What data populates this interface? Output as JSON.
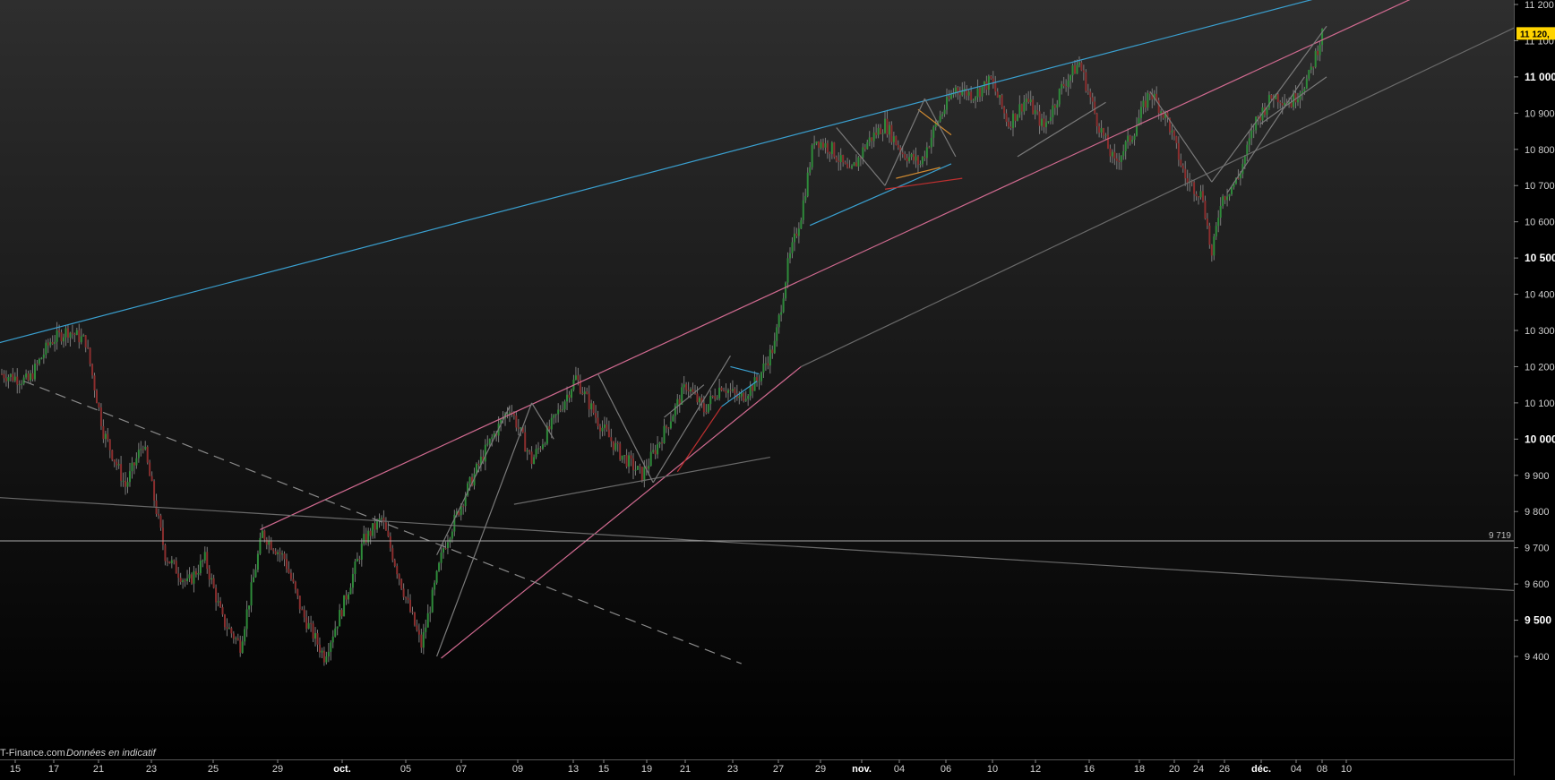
{
  "chart_data": {
    "type": "candlestick",
    "instrument_price_tag": "11 120,",
    "y_range": [
      9350,
      11220
    ],
    "y_ticks": [
      {
        "value": 9400,
        "label": "9 400",
        "major": false
      },
      {
        "value": 9500,
        "label": "9 500",
        "major": true
      },
      {
        "value": 9600,
        "label": "9 600",
        "major": false
      },
      {
        "value": 9700,
        "label": "9 700",
        "major": false
      },
      {
        "value": 9800,
        "label": "9 800",
        "major": false
      },
      {
        "value": 9900,
        "label": "9 900",
        "major": false
      },
      {
        "value": 10000,
        "label": "10 000",
        "major": true
      },
      {
        "value": 10100,
        "label": "10 100",
        "major": false
      },
      {
        "value": 10200,
        "label": "10 200",
        "major": false
      },
      {
        "value": 10300,
        "label": "10 300",
        "major": false
      },
      {
        "value": 10400,
        "label": "10 400",
        "major": false
      },
      {
        "value": 10500,
        "label": "10 500",
        "major": true
      },
      {
        "value": 10600,
        "label": "10 600",
        "major": false
      },
      {
        "value": 10700,
        "label": "10 700",
        "major": false
      },
      {
        "value": 10800,
        "label": "10 800",
        "major": false
      },
      {
        "value": 10900,
        "label": "10 900",
        "major": false
      },
      {
        "value": 11000,
        "label": "11 000",
        "major": true
      },
      {
        "value": 11100,
        "label": "11 100",
        "major": false
      },
      {
        "value": 11200,
        "label": "11 200",
        "major": false
      }
    ],
    "x_ticks": [
      {
        "label": "15",
        "major": false
      },
      {
        "label": "17",
        "major": false
      },
      {
        "label": "21",
        "major": false
      },
      {
        "label": "23",
        "major": false
      },
      {
        "label": "25",
        "major": false
      },
      {
        "label": "29",
        "major": false
      },
      {
        "label": "oct.",
        "major": true
      },
      {
        "label": "05",
        "major": false
      },
      {
        "label": "07",
        "major": false
      },
      {
        "label": "09",
        "major": false
      },
      {
        "label": "13",
        "major": false
      },
      {
        "label": "15",
        "major": false
      },
      {
        "label": "19",
        "major": false
      },
      {
        "label": "21",
        "major": false
      },
      {
        "label": "23",
        "major": false
      },
      {
        "label": "27",
        "major": false
      },
      {
        "label": "29",
        "major": false
      },
      {
        "label": "nov.",
        "major": true
      },
      {
        "label": "04",
        "major": false
      },
      {
        "label": "06",
        "major": false
      },
      {
        "label": "10",
        "major": false
      },
      {
        "label": "12",
        "major": false
      },
      {
        "label": "16",
        "major": false
      },
      {
        "label": "18",
        "major": false
      },
      {
        "label": "20",
        "major": false
      },
      {
        "label": "24",
        "major": false
      },
      {
        "label": "26",
        "major": false
      },
      {
        "label": "déc.",
        "major": true
      },
      {
        "label": "04",
        "major": false
      },
      {
        "label": "08",
        "major": false
      },
      {
        "label": "10",
        "major": false
      }
    ],
    "horizontal_line": {
      "value": 9719,
      "label": "9 719",
      "color": "#aaaaaa"
    },
    "price_path": [
      {
        "i": 0,
        "p": 10180
      },
      {
        "i": 12,
        "p": 10160
      },
      {
        "i": 22,
        "p": 10270
      },
      {
        "i": 30,
        "p": 10300
      },
      {
        "i": 38,
        "p": 10270
      },
      {
        "i": 46,
        "p": 10020
      },
      {
        "i": 56,
        "p": 9870
      },
      {
        "i": 64,
        "p": 9990
      },
      {
        "i": 74,
        "p": 9680
      },
      {
        "i": 84,
        "p": 9600
      },
      {
        "i": 92,
        "p": 9670
      },
      {
        "i": 100,
        "p": 9500
      },
      {
        "i": 108,
        "p": 9430
      },
      {
        "i": 118,
        "p": 9740
      },
      {
        "i": 128,
        "p": 9670
      },
      {
        "i": 136,
        "p": 9520
      },
      {
        "i": 146,
        "p": 9400
      },
      {
        "i": 154,
        "p": 9530
      },
      {
        "i": 164,
        "p": 9720
      },
      {
        "i": 172,
        "p": 9780
      },
      {
        "i": 182,
        "p": 9580
      },
      {
        "i": 190,
        "p": 9430
      },
      {
        "i": 200,
        "p": 9700
      },
      {
        "i": 210,
        "p": 9850
      },
      {
        "i": 220,
        "p": 9980
      },
      {
        "i": 230,
        "p": 10090
      },
      {
        "i": 240,
        "p": 9940
      },
      {
        "i": 250,
        "p": 10050
      },
      {
        "i": 260,
        "p": 10170
      },
      {
        "i": 270,
        "p": 10050
      },
      {
        "i": 280,
        "p": 9960
      },
      {
        "i": 290,
        "p": 9900
      },
      {
        "i": 300,
        "p": 10020
      },
      {
        "i": 310,
        "p": 10150
      },
      {
        "i": 318,
        "p": 10080
      },
      {
        "i": 326,
        "p": 10150
      },
      {
        "i": 334,
        "p": 10110
      },
      {
        "i": 342,
        "p": 10160
      },
      {
        "i": 350,
        "p": 10260
      },
      {
        "i": 356,
        "p": 10480
      },
      {
        "i": 362,
        "p": 10620
      },
      {
        "i": 368,
        "p": 10830
      },
      {
        "i": 376,
        "p": 10800
      },
      {
        "i": 384,
        "p": 10730
      },
      {
        "i": 392,
        "p": 10820
      },
      {
        "i": 400,
        "p": 10870
      },
      {
        "i": 408,
        "p": 10790
      },
      {
        "i": 416,
        "p": 10760
      },
      {
        "i": 424,
        "p": 10880
      },
      {
        "i": 432,
        "p": 10970
      },
      {
        "i": 440,
        "p": 10950
      },
      {
        "i": 448,
        "p": 10990
      },
      {
        "i": 456,
        "p": 10870
      },
      {
        "i": 464,
        "p": 10940
      },
      {
        "i": 472,
        "p": 10860
      },
      {
        "i": 480,
        "p": 10970
      },
      {
        "i": 488,
        "p": 11040
      },
      {
        "i": 496,
        "p": 10880
      },
      {
        "i": 504,
        "p": 10760
      },
      {
        "i": 512,
        "p": 10840
      },
      {
        "i": 520,
        "p": 10960
      },
      {
        "i": 528,
        "p": 10880
      },
      {
        "i": 536,
        "p": 10720
      },
      {
        "i": 544,
        "p": 10670
      },
      {
        "i": 548,
        "p": 10500
      },
      {
        "i": 552,
        "p": 10660
      },
      {
        "i": 560,
        "p": 10720
      },
      {
        "i": 568,
        "p": 10880
      },
      {
        "i": 576,
        "p": 10950
      },
      {
        "i": 584,
        "p": 10930
      },
      {
        "i": 592,
        "p": 11000
      },
      {
        "i": 598,
        "p": 11120
      }
    ],
    "trendlines": [
      {
        "name": "upper-blue-channel",
        "color": "#3aa0d0",
        "style": "solid",
        "from": [
          -5,
          10260
        ],
        "to": [
          610,
          11240
        ]
      },
      {
        "name": "pink-upper",
        "color": "#d06a90",
        "style": "solid",
        "from": [
          117,
          9750
        ],
        "to": [
          640,
          11220
        ]
      },
      {
        "name": "pink-lower",
        "color": "#d06a90",
        "style": "solid",
        "from": [
          199,
          9395
        ],
        "to": [
          362,
          10200
        ]
      },
      {
        "name": "grey-mid-trend",
        "color": "#6a6a6a",
        "style": "solid",
        "from": [
          362,
          10200
        ],
        "to": [
          690,
          11150
        ]
      },
      {
        "name": "grey-long-down",
        "color": "#6a6a6a",
        "style": "solid",
        "from": [
          -5,
          9840
        ],
        "to": [
          690,
          9580
        ]
      },
      {
        "name": "dashed-down",
        "color": "#8a8a8a",
        "style": "dashed",
        "from": [
          10,
          10160
        ],
        "to": [
          335,
          9380
        ]
      },
      {
        "name": "grey-small-flat",
        "color": "#6a6a6a",
        "style": "solid",
        "from": [
          232,
          9820
        ],
        "to": [
          348,
          9950
        ]
      },
      {
        "name": "blue-mid-1",
        "color": "#3aa0d0",
        "style": "solid",
        "from": [
          366,
          10590
        ],
        "to": [
          430,
          10760
        ]
      },
      {
        "name": "blue-small-2",
        "color": "#3aa0d0",
        "style": "solid",
        "from": [
          330,
          10200
        ],
        "to": [
          343,
          10180
        ]
      },
      {
        "name": "blue-small-3",
        "color": "#3aa0d0",
        "style": "solid",
        "from": [
          326,
          10090
        ],
        "to": [
          342,
          10160
        ]
      },
      {
        "name": "red-small-1",
        "color": "#c03030",
        "style": "solid",
        "from": [
          306,
          9910
        ],
        "to": [
          326,
          10090
        ]
      },
      {
        "name": "red-mid-1",
        "color": "#c03030",
        "style": "solid",
        "from": [
          400,
          10690
        ],
        "to": [
          435,
          10720
        ]
      },
      {
        "name": "orange-mid-1",
        "color": "#d08a30",
        "style": "solid",
        "from": [
          415,
          10910
        ],
        "to": [
          430,
          10840
        ]
      },
      {
        "name": "orange-mid-2",
        "color": "#d08a30",
        "style": "solid",
        "from": [
          405,
          10720
        ],
        "to": [
          425,
          10750
        ]
      },
      {
        "name": "grey-pattern-1",
        "color": "#7a7a7a",
        "style": "solid",
        "from": [
          197,
          9400
        ],
        "to": [
          240,
          10100
        ]
      },
      {
        "name": "grey-pattern-2",
        "color": "#7a7a7a",
        "style": "solid",
        "from": [
          197,
          9680
        ],
        "to": [
          230,
          10090
        ]
      },
      {
        "name": "grey-pattern-3",
        "color": "#7a7a7a",
        "style": "solid",
        "from": [
          240,
          10100
        ],
        "to": [
          250,
          10000
        ]
      },
      {
        "name": "grey-pattern-4",
        "color": "#7a7a7a",
        "style": "solid",
        "from": [
          270,
          10180
        ],
        "to": [
          295,
          9880
        ]
      },
      {
        "name": "grey-pattern-5",
        "color": "#7a7a7a",
        "style": "solid",
        "from": [
          295,
          9880
        ],
        "to": [
          330,
          10230
        ]
      },
      {
        "name": "grey-pattern-6",
        "color": "#7a7a7a",
        "style": "solid",
        "from": [
          300,
          10060
        ],
        "to": [
          318,
          10150
        ]
      },
      {
        "name": "grey-pattern-7",
        "color": "#7a7a7a",
        "style": "solid",
        "from": [
          378,
          10860
        ],
        "to": [
          400,
          10700
        ]
      },
      {
        "name": "grey-pattern-8",
        "color": "#7a7a7a",
        "style": "solid",
        "from": [
          400,
          10700
        ],
        "to": [
          418,
          10940
        ]
      },
      {
        "name": "grey-pattern-9",
        "color": "#7a7a7a",
        "style": "solid",
        "from": [
          418,
          10940
        ],
        "to": [
          432,
          10780
        ]
      },
      {
        "name": "grey-pattern-10",
        "color": "#7a7a7a",
        "style": "solid",
        "from": [
          460,
          10780
        ],
        "to": [
          500,
          10930
        ]
      },
      {
        "name": "grey-pattern-11",
        "color": "#7a7a7a",
        "style": "solid",
        "from": [
          520,
          10960
        ],
        "to": [
          548,
          10710
        ]
      },
      {
        "name": "grey-pattern-12",
        "color": "#7a7a7a",
        "style": "solid",
        "from": [
          555,
          10680
        ],
        "to": [
          590,
          11000
        ]
      },
      {
        "name": "grey-pattern-13",
        "color": "#7a7a7a",
        "style": "solid",
        "from": [
          548,
          10710
        ],
        "to": [
          600,
          11140
        ]
      },
      {
        "name": "grey-pattern-14",
        "color": "#7a7a7a",
        "style": "solid",
        "from": [
          570,
          10870
        ],
        "to": [
          600,
          11000
        ]
      }
    ]
  },
  "footer": {
    "credit_brand": "T-Finance.com",
    "credit_note": "Données en indicatif"
  },
  "colors": {
    "background_top": "#2e2e2e",
    "background_bottom": "#000000",
    "axis_panel": "#000000",
    "up_candle": "#2e8b3a",
    "down_candle": "#8b2e2e",
    "wick": "#7a7a7a",
    "price_tag_bg": "#ffd400"
  }
}
